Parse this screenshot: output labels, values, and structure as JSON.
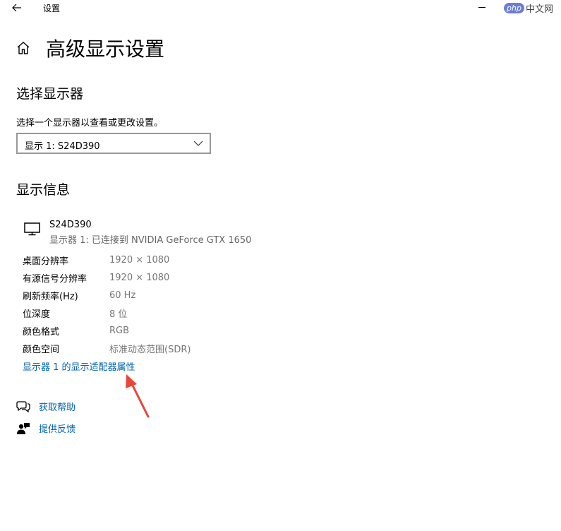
{
  "titlebar": {
    "title": "设置",
    "watermark_php": "php",
    "watermark_cn": "中文网"
  },
  "page": {
    "title": "高级显示设置"
  },
  "select_display": {
    "heading": "选择显示器",
    "description": "选择一个显示器以查看或更改设置。",
    "selected": "显示 1: S24D390"
  },
  "display_info": {
    "heading": "显示信息",
    "monitor_name": "S24D390",
    "monitor_sub": "显示器 1: 已连接到 NVIDIA GeForce GTX 1650",
    "rows": [
      {
        "label": "桌面分辨率",
        "value": "1920 × 1080"
      },
      {
        "label": "有源信号分辨率",
        "value": "1920 × 1080"
      },
      {
        "label": "刷新频率(Hz)",
        "value": "60 Hz"
      },
      {
        "label": "位深度",
        "value": "8 位"
      },
      {
        "label": "颜色格式",
        "value": "RGB"
      },
      {
        "label": "颜色空间",
        "value": "标准动态范围(SDR)"
      }
    ],
    "adapter_link": "显示器 1 的显示适配器属性"
  },
  "help": {
    "get_help": "获取帮助",
    "feedback": "提供反馈"
  },
  "colors": {
    "link": "#0063b1",
    "arrow": "#e8463a"
  }
}
